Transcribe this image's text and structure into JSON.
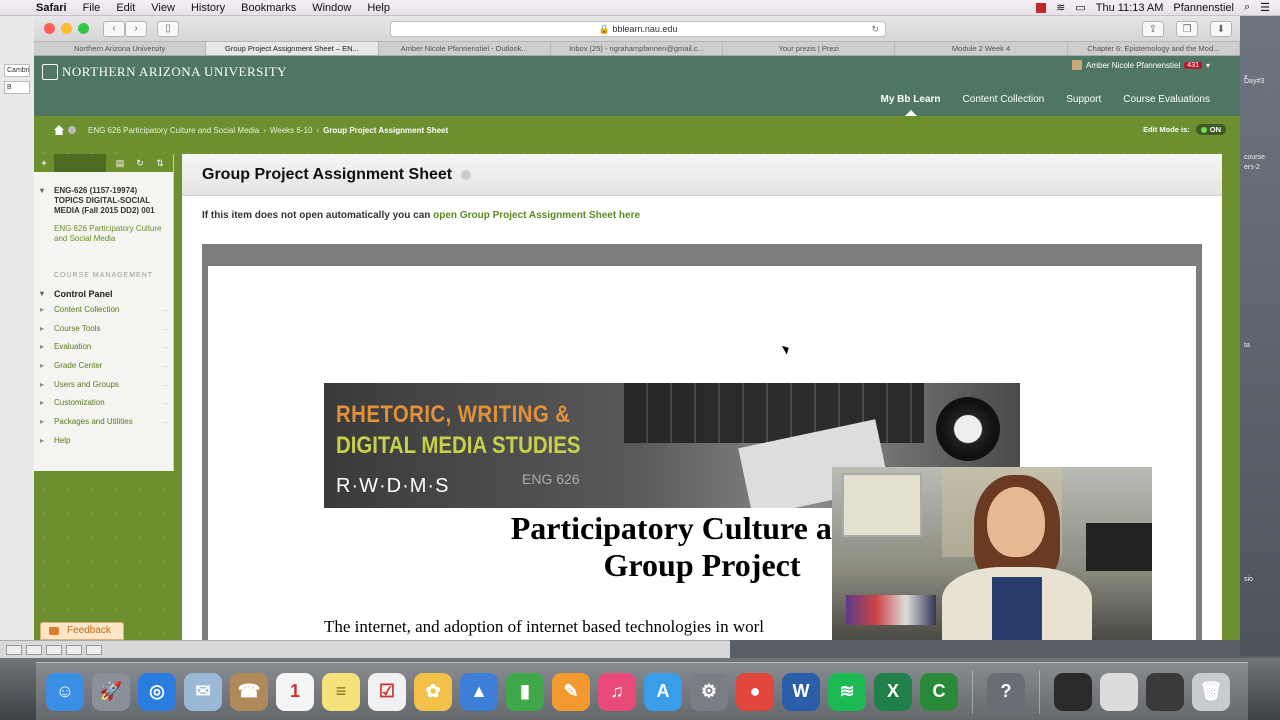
{
  "menubar": {
    "app": "Safari",
    "items": [
      "File",
      "Edit",
      "View",
      "History",
      "Bookmarks",
      "Window",
      "Help"
    ],
    "clock": "Thu 11:13 AM",
    "user": "Pfannenstiel"
  },
  "desktop": {
    "left_text": [
      "Cambri",
      "B"
    ],
    "right_text": [
      "course",
      "ers-2",
      "Day#3",
      "ta",
      "sio",
      "x"
    ]
  },
  "browser": {
    "url": "bblearn.nau.edu",
    "tabs": [
      {
        "label": "Northern Arizona University",
        "active": false
      },
      {
        "label": "Group Project Assignment Sheet – EN...",
        "active": true
      },
      {
        "label": "Amber Nicole Pfannenstiel - Outlook...",
        "active": false
      },
      {
        "label": "Inbox (25) - ngrahampfannen@gmail.c...",
        "active": false
      },
      {
        "label": "Your prezis | Prezi",
        "active": false
      },
      {
        "label": "Module 2 Week 4",
        "active": false
      },
      {
        "label": "Chapter 6: Epistemology and the Mod...",
        "active": false
      }
    ]
  },
  "bb": {
    "logo_text": "NORTHERN ARIZONA UNIVERSITY",
    "user_name": "Amber Nicole Pfannenstiel",
    "notification_count": "431",
    "topnav": [
      "My Bb Learn",
      "Content Collection",
      "Support",
      "Course Evaluations"
    ],
    "breadcrumb": [
      "ENG 626 Participatory Culture and Social Media",
      "Weeks 6-10",
      "Group Project Assignment Sheet"
    ],
    "edit_mode_label": "Edit Mode is:",
    "edit_mode_value": "ON"
  },
  "course_menu": {
    "course_title": "ENG-626 (1157-19974) TOPICS DIGITAL-SOCIAL MEDIA (Fall 2015 DD2) 001",
    "course_sub": "ENG 626 Participatory Culture and Social Media",
    "section_label": "COURSE MANAGEMENT",
    "control_panel": "Control Panel",
    "items": [
      "Content Collection",
      "Course Tools",
      "Evaluation",
      "Grade Center",
      "Users and Groups",
      "Customization",
      "Packages and Utilities",
      "Help"
    ]
  },
  "page": {
    "title": "Group Project Assignment Sheet",
    "notice_text": "If this item does not open automatically you can ",
    "notice_link": "open Group Project Assignment Sheet here"
  },
  "document": {
    "banner_line1": "RHETORIC, WRITING &",
    "banner_line2": "DIGITAL MEDIA STUDIES",
    "banner_abbrev": "R·W·D·M·S",
    "banner_course": "ENG 626",
    "heading_line1": "Participatory Culture and S",
    "heading_line2": "Group Project",
    "paragraph": "The internet, and adoption of internet based technologies in worl"
  },
  "feedback_label": "Feedback",
  "dock": {
    "apps": [
      {
        "name": "finder",
        "color": "#3a8ee6",
        "glyph": "☺"
      },
      {
        "name": "launchpad",
        "color": "#8a8f99",
        "glyph": "🚀"
      },
      {
        "name": "safari",
        "color": "#2a7de0",
        "glyph": "◎"
      },
      {
        "name": "mail",
        "color": "#9bb8d8",
        "glyph": "✉"
      },
      {
        "name": "contacts",
        "color": "#b08a5a",
        "glyph": "☎"
      },
      {
        "name": "calendar",
        "color": "#f4f4f4",
        "glyph": "1"
      },
      {
        "name": "notes",
        "color": "#f5e27a",
        "glyph": "≡"
      },
      {
        "name": "reminders",
        "color": "#f0f0f0",
        "glyph": "☑"
      },
      {
        "name": "photos",
        "color": "#f3c04a",
        "glyph": "✿"
      },
      {
        "name": "keynote",
        "color": "#3d7fd8",
        "glyph": "▲"
      },
      {
        "name": "numbers",
        "color": "#3fa84a",
        "glyph": "▮"
      },
      {
        "name": "pages",
        "color": "#f29a30",
        "glyph": "✎"
      },
      {
        "name": "itunes",
        "color": "#e84a7a",
        "glyph": "♫"
      },
      {
        "name": "app-store",
        "color": "#3a9de8",
        "glyph": "A"
      },
      {
        "name": "system-preferences",
        "color": "#7a7e84",
        "glyph": "⚙"
      },
      {
        "name": "chrome",
        "color": "#e0463a",
        "glyph": "●"
      },
      {
        "name": "word",
        "color": "#2b5ea8",
        "glyph": "W"
      },
      {
        "name": "spotify",
        "color": "#1db954",
        "glyph": "≋"
      },
      {
        "name": "excel",
        "color": "#21804a",
        "glyph": "X"
      },
      {
        "name": "camtasia",
        "color": "#2a8a3a",
        "glyph": "C"
      },
      {
        "name": "help",
        "color": "#6a6e74",
        "glyph": "?"
      },
      {
        "name": "window-thumb-1",
        "color": "#2a2a2a",
        "glyph": ""
      },
      {
        "name": "window-thumb-2",
        "color": "#dcdcdc",
        "glyph": ""
      },
      {
        "name": "window-thumb-3",
        "color": "#3a3a3a",
        "glyph": ""
      },
      {
        "name": "trash",
        "color": "#c8ccd0",
        "glyph": "🗑"
      }
    ]
  }
}
